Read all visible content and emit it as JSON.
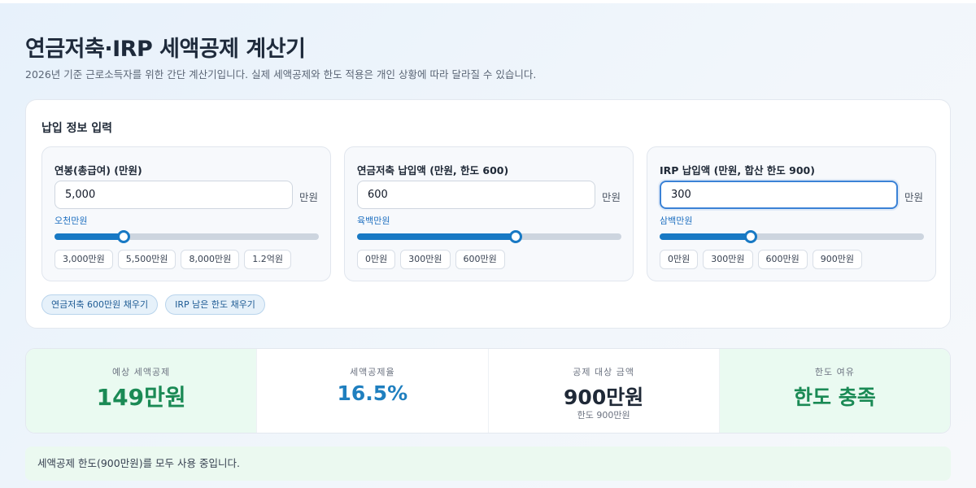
{
  "header": {
    "title": "연금저축·IRP 세액공제 계산기",
    "subtitle": "2026년 기준 근로소득자를 위한 간단 계산기입니다. 실제 세액공제와 한도 적용은 개인 상황에 따라 달라질 수 있습니다."
  },
  "input_panel": {
    "title": "납입 정보 입력",
    "cards": [
      {
        "label": "연봉(총급여) (만원)",
        "value": "5,000",
        "unit": "만원",
        "in_words": "오천만원",
        "slider_fraction": 0.26,
        "presets": [
          "3,000만원",
          "5,500만원",
          "8,000만원",
          "1.2억원"
        ]
      },
      {
        "label": "연금저축 납입액 (만원, 한도 600)",
        "value": "600",
        "unit": "만원",
        "in_words": "육백만원",
        "slider_fraction": 0.6,
        "presets": [
          "0만원",
          "300만원",
          "600만원"
        ]
      },
      {
        "label": "IRP 납입액 (만원, 합산 한도 900)",
        "value": "300",
        "unit": "만원",
        "in_words": "삼백만원",
        "slider_fraction": 0.345,
        "presets": [
          "0만원",
          "300만원",
          "600만원",
          "900만원"
        ]
      }
    ],
    "quick_buttons": [
      "연금저축 600만원 채우기",
      "IRP 남은 한도 채우기"
    ]
  },
  "stats": [
    {
      "label": "예상 세액공제",
      "value": "149만원",
      "sub": "",
      "color": "#1a8a55"
    },
    {
      "label": "세액공제율",
      "value": "16.5%",
      "sub": "",
      "color": "#1f7fbf"
    },
    {
      "label": "공제 대상 금액",
      "value": "900만원",
      "sub": "한도 900만원",
      "color": "#1f2937"
    },
    {
      "label": "한도 여유",
      "value": "한도 충족",
      "sub": "",
      "color": "#1a8a55"
    }
  ],
  "notice": "세액공제 한도(900만원)를 모두 사용 중입니다."
}
